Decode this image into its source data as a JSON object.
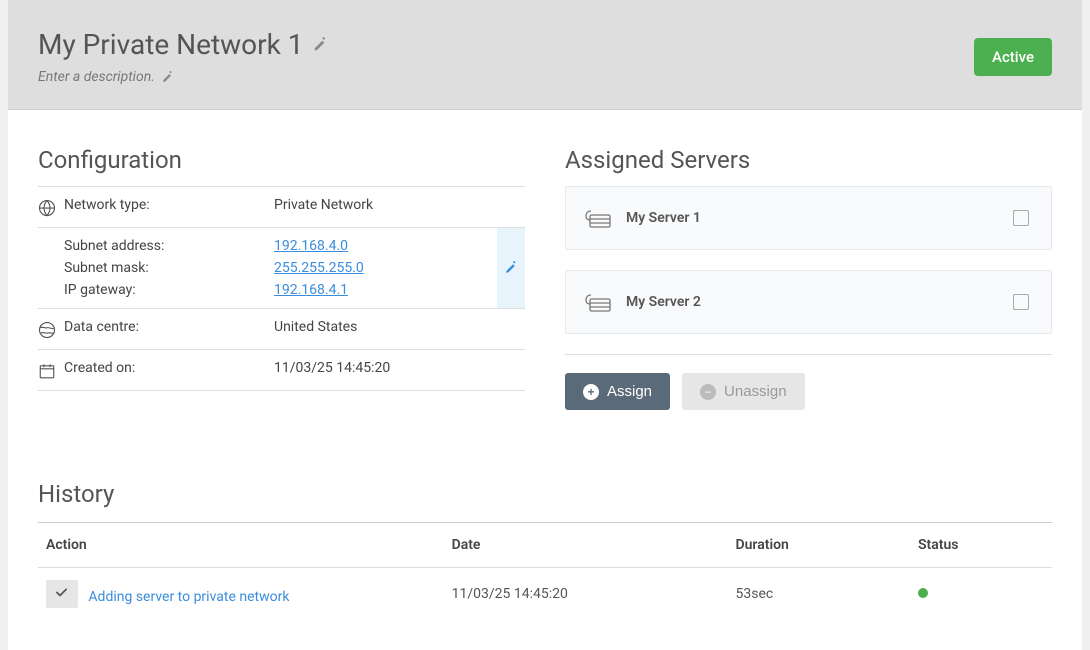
{
  "header": {
    "title": "My Private Network 1",
    "description_placeholder": "Enter a description.",
    "status": "Active"
  },
  "configuration": {
    "title": "Configuration",
    "rows": {
      "network_type": {
        "label": "Network type:",
        "value": "Private Network"
      },
      "subnet_address": {
        "label": "Subnet address:",
        "value": "192.168.4.0"
      },
      "subnet_mask": {
        "label": "Subnet mask:",
        "value": "255.255.255.0"
      },
      "ip_gateway": {
        "label": "IP gateway:",
        "value": "192.168.4.1"
      },
      "data_centre": {
        "label": "Data centre:",
        "value": "United States"
      },
      "created_on": {
        "label": "Created on:",
        "value": "11/03/25 14:45:20"
      }
    }
  },
  "assigned_servers": {
    "title": "Assigned Servers",
    "servers": [
      {
        "name": "My Server 1"
      },
      {
        "name": "My Server 2"
      }
    ],
    "assign_label": "Assign",
    "unassign_label": "Unassign"
  },
  "history": {
    "title": "History",
    "columns": {
      "action": "Action",
      "date": "Date",
      "duration": "Duration",
      "status": "Status"
    },
    "rows": [
      {
        "action": "Adding server to private network",
        "date": "11/03/25 14:45:20",
        "duration": "53sec",
        "status": "ok"
      }
    ]
  }
}
